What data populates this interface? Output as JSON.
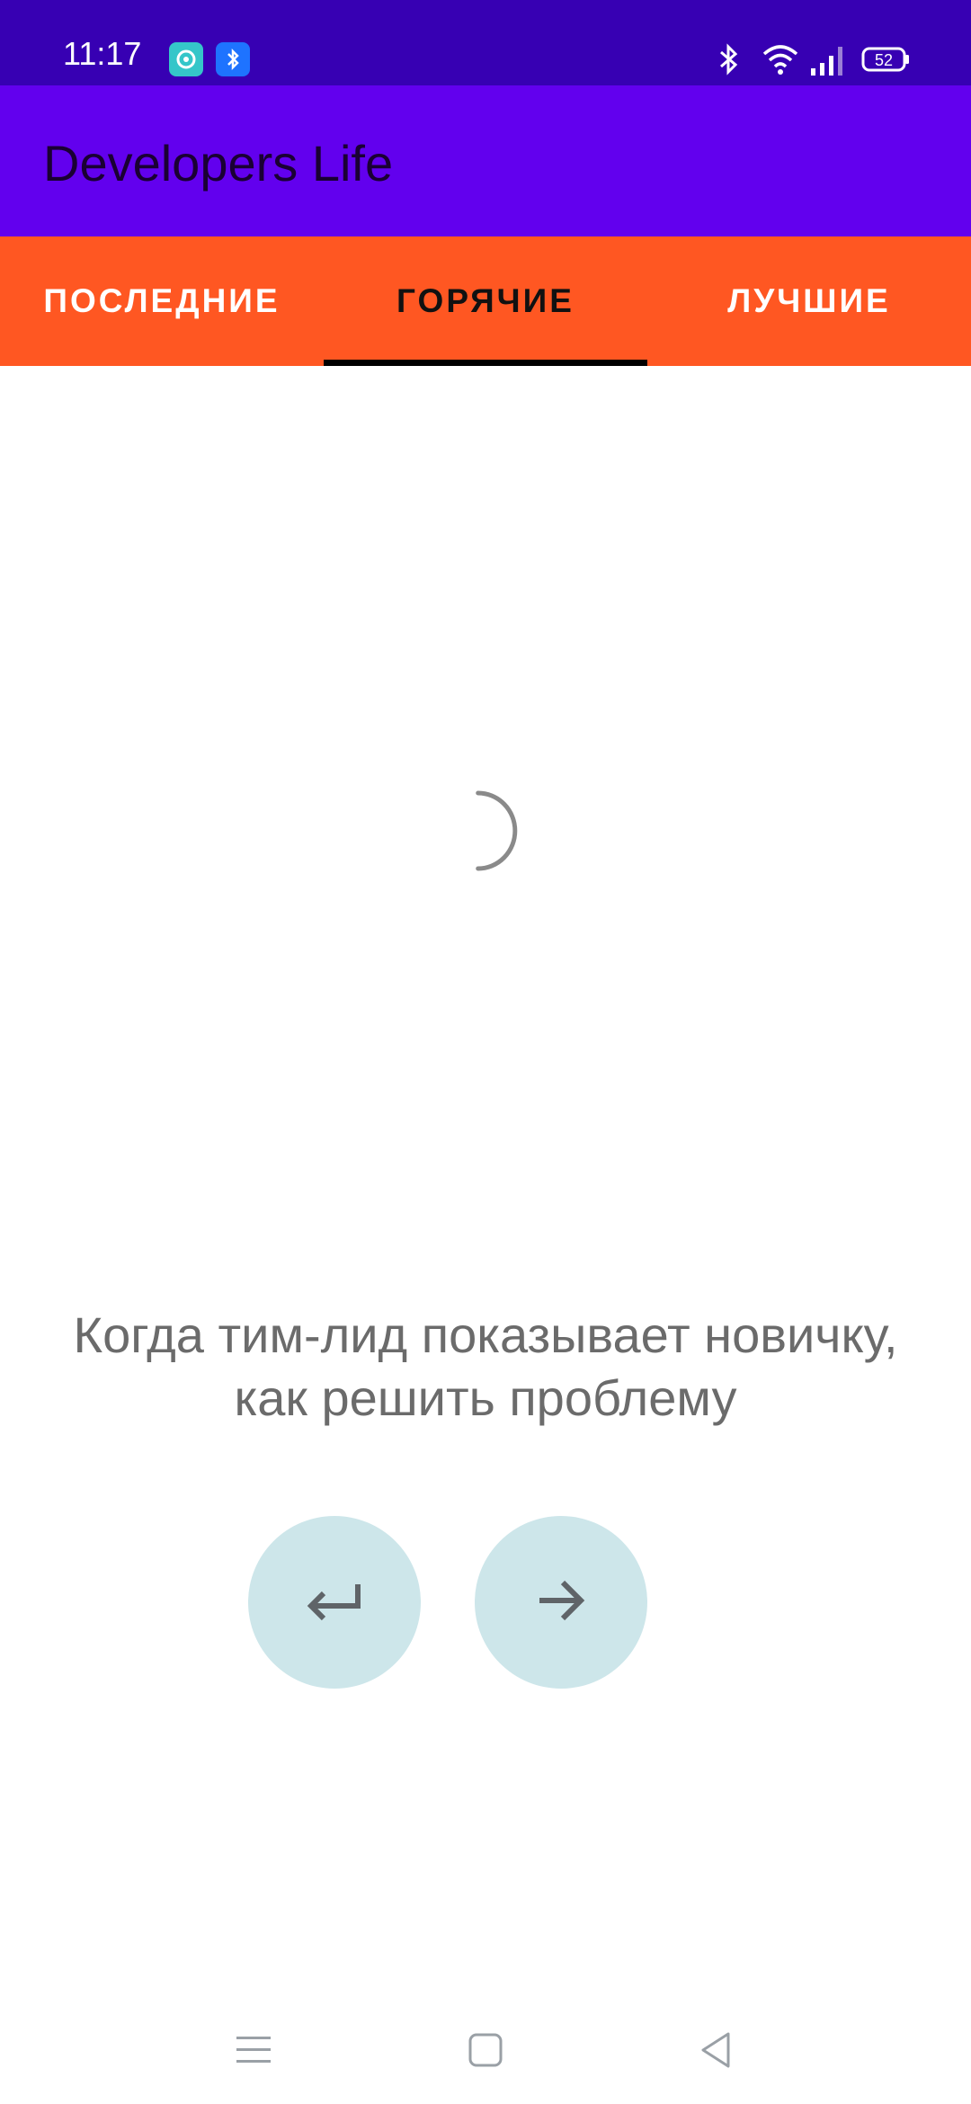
{
  "status_bar": {
    "time": "11:17",
    "battery": "52",
    "icons": [
      "notification-app-icon",
      "bluetooth-app-icon",
      "bluetooth-icon",
      "wifi-icon",
      "signal-icon",
      "battery-icon"
    ]
  },
  "app_bar": {
    "title": "Developers Life"
  },
  "tabs": [
    {
      "label": "ПОСЛЕДНИЕ",
      "active": false
    },
    {
      "label": "ГОРЯЧИЕ",
      "active": true
    },
    {
      "label": "ЛУЧШИЕ",
      "active": false
    }
  ],
  "content": {
    "loading": true,
    "caption": "Когда тим-лид показывает новичку, как решить проблему"
  },
  "controls": {
    "back_icon": "return-arrow-icon",
    "next_icon": "arrow-right-icon"
  },
  "nav_bar": {
    "icons": [
      "menu-icon",
      "home-icon",
      "back-icon"
    ]
  },
  "colors": {
    "status_bar": "#3700b3",
    "app_bar": "#6200ee",
    "tab_bar": "#ff5722",
    "button_bg": "#cde6ea"
  }
}
